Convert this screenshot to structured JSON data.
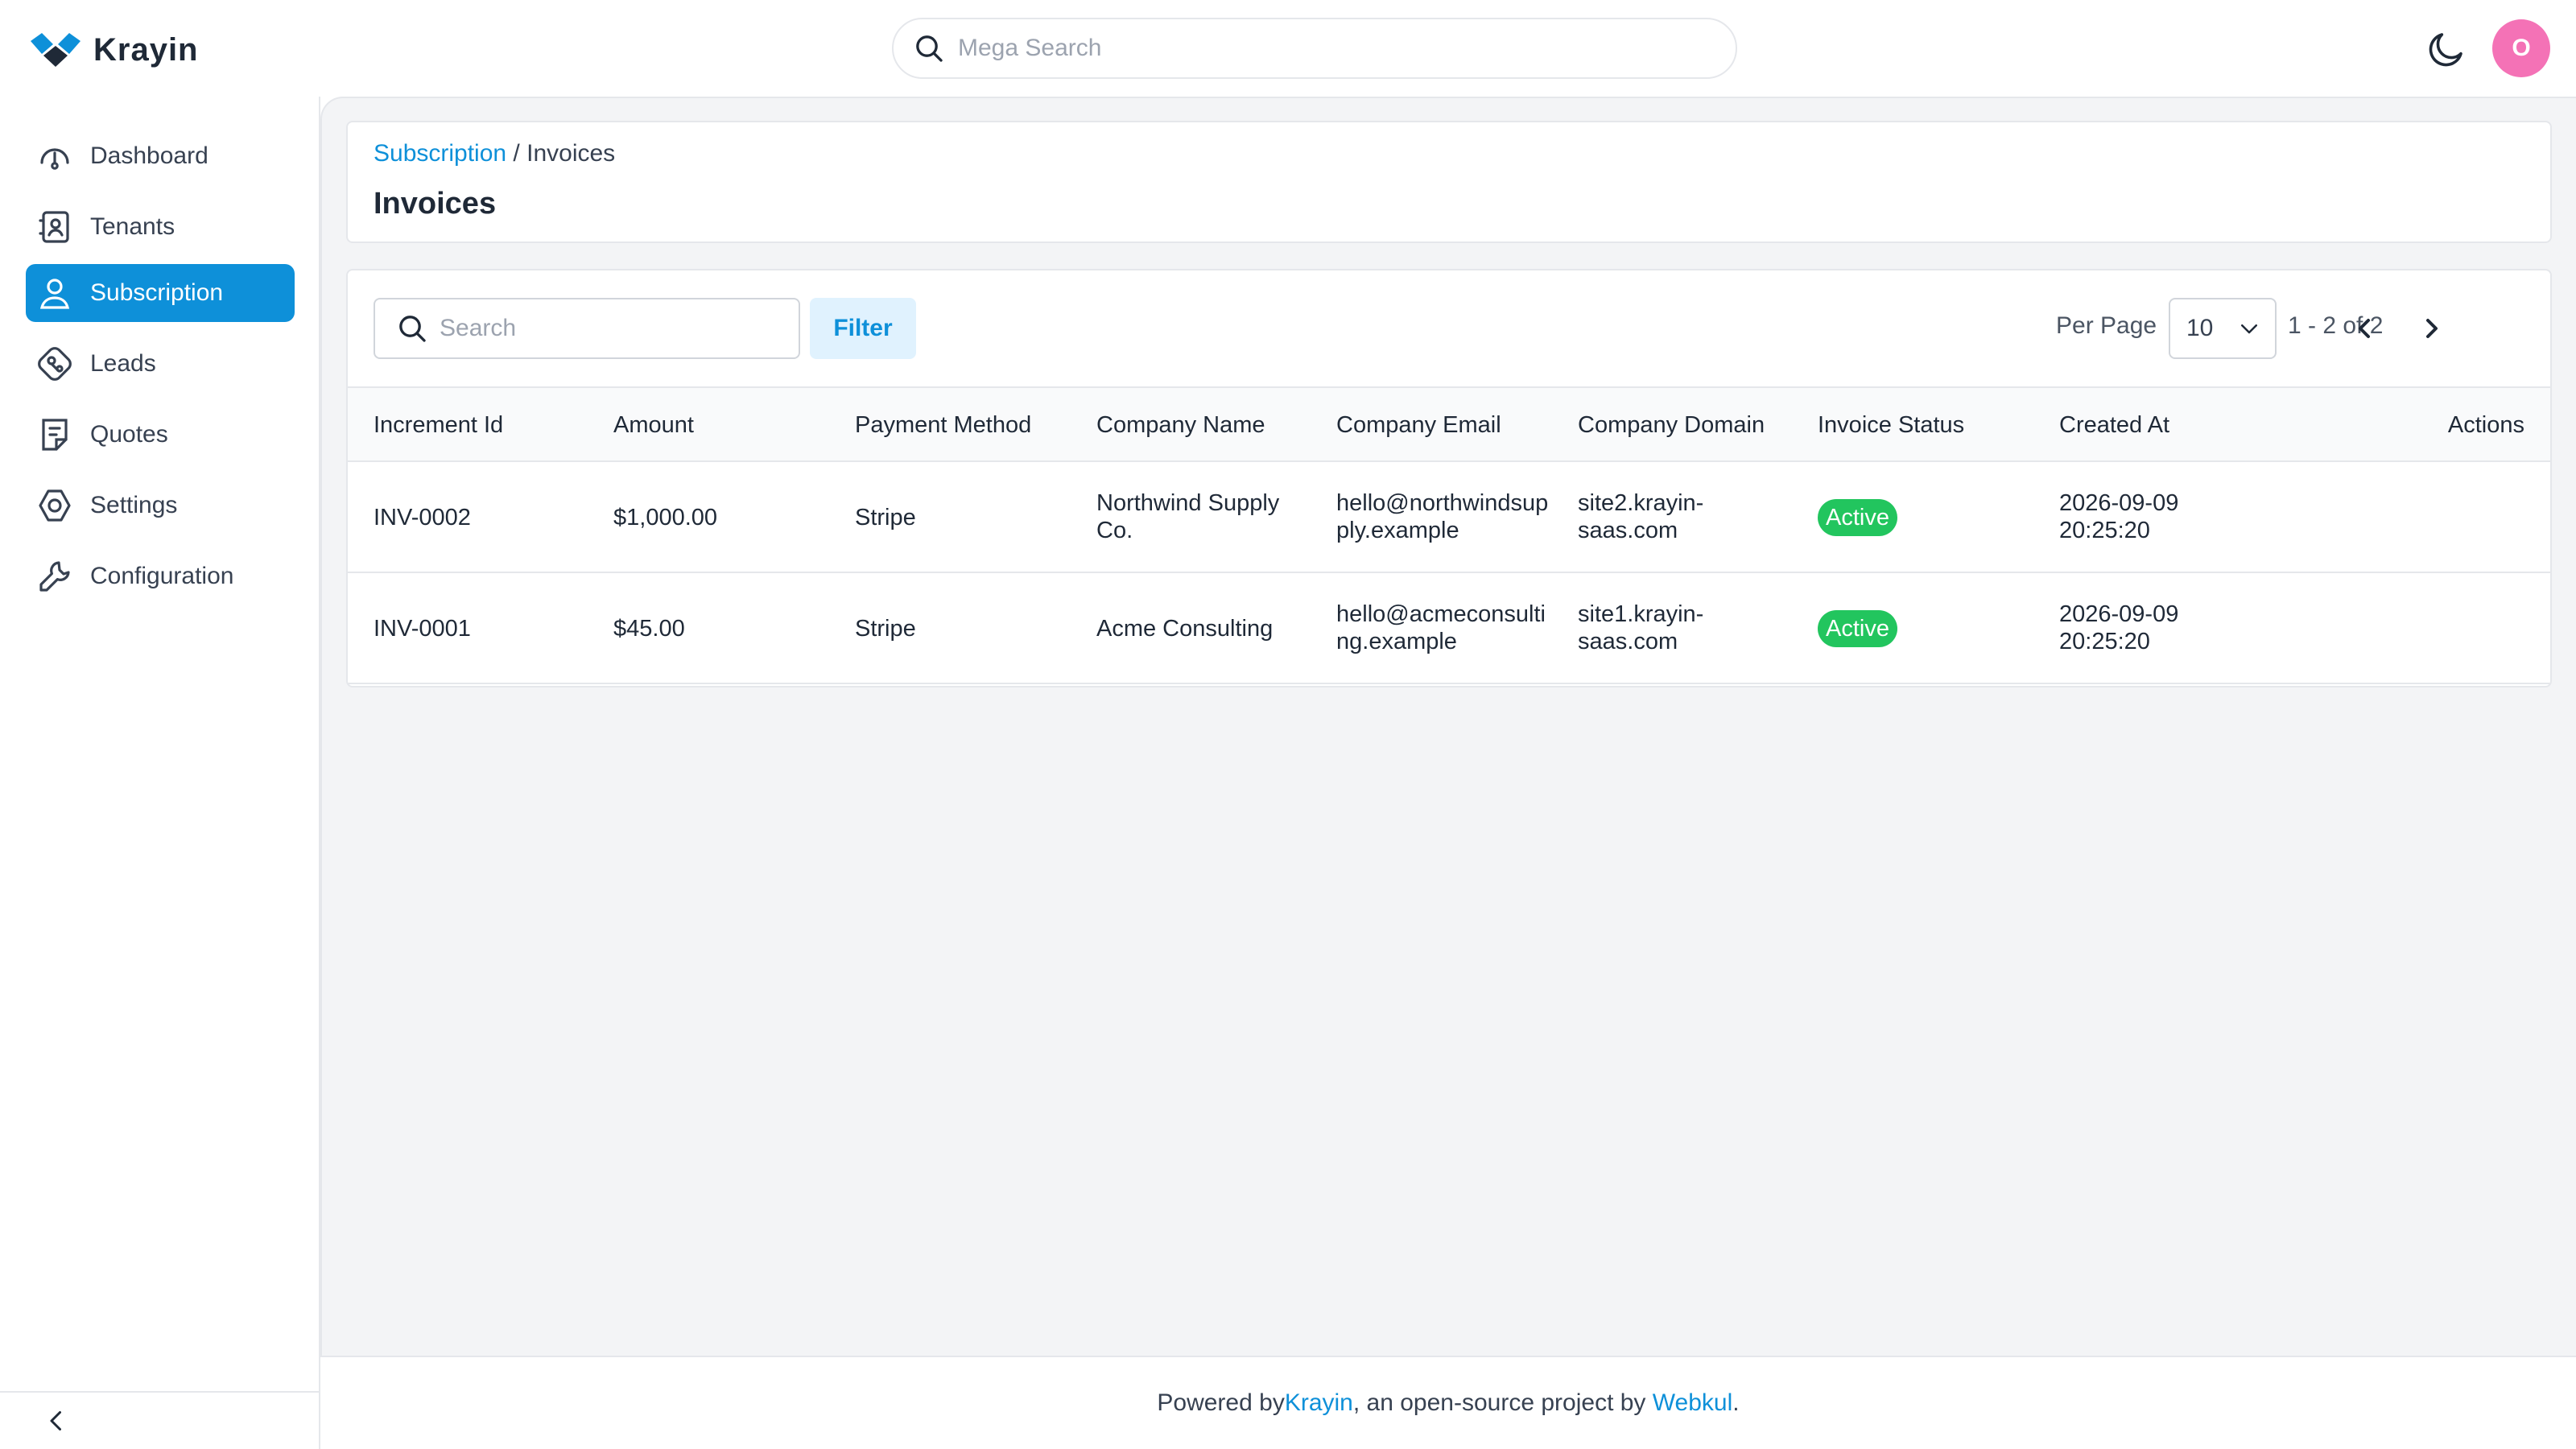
{
  "app": {
    "name": "Krayin",
    "brand_color": "#0e90d9"
  },
  "topbar": {
    "search_placeholder": "Mega Search",
    "avatar_initial": "O"
  },
  "sidebar": {
    "items": [
      {
        "label": "Dashboard",
        "icon": "dashboard-gauge-icon"
      },
      {
        "label": "Tenants",
        "icon": "tenants-contact-icon"
      },
      {
        "label": "Subscription",
        "icon": "user-icon",
        "active": true
      },
      {
        "label": "Leads",
        "icon": "leads-icon"
      },
      {
        "label": "Quotes",
        "icon": "quotes-icon"
      },
      {
        "label": "Settings",
        "icon": "settings-icon"
      },
      {
        "label": "Configuration",
        "icon": "wrench-icon"
      }
    ]
  },
  "breadcrumb": {
    "parent": "Subscription",
    "separator": " / ",
    "current": "Invoices"
  },
  "page": {
    "title": "Invoices"
  },
  "toolbar": {
    "search_placeholder": "Search",
    "filter_label": "Filter",
    "per_page_label": "Per Page",
    "per_page_value": "10",
    "page_info": "1 - 2 of 2"
  },
  "table": {
    "headers": [
      "Increment Id",
      "Amount",
      "Payment Method",
      "Company Name",
      "Company Email",
      "Company Domain",
      "Invoice Status",
      "Created At",
      "Actions"
    ],
    "rows": [
      {
        "increment_id": "INV-0002",
        "amount": "$1,000.00",
        "payment_method": "Stripe",
        "company_name_1": "Northwind Supply",
        "company_name_2": "Co.",
        "email_1": "hello@northwindsup",
        "email_2": "ply.example",
        "domain_1": "site2.krayin-",
        "domain_2": "saas.com",
        "status": "Active",
        "created_date": "2026-09-09",
        "created_time": "20:25:20"
      },
      {
        "increment_id": "INV-0001",
        "amount": "$45.00",
        "payment_method": "Stripe",
        "company_name": "Acme Consulting",
        "email_1": "hello@acmeconsulti",
        "email_2": "ng.example",
        "domain_1": "site1.krayin-",
        "domain_2": "saas.com",
        "status": "Active",
        "created_date": "2026-09-09",
        "created_time": "20:25:20"
      }
    ],
    "status_color": "#22c55e"
  },
  "footer": {
    "prefix": "Powered by ",
    "link1": "Krayin",
    "middle": ", an open-source project by ",
    "link2": "Webkul",
    "suffix": "."
  }
}
